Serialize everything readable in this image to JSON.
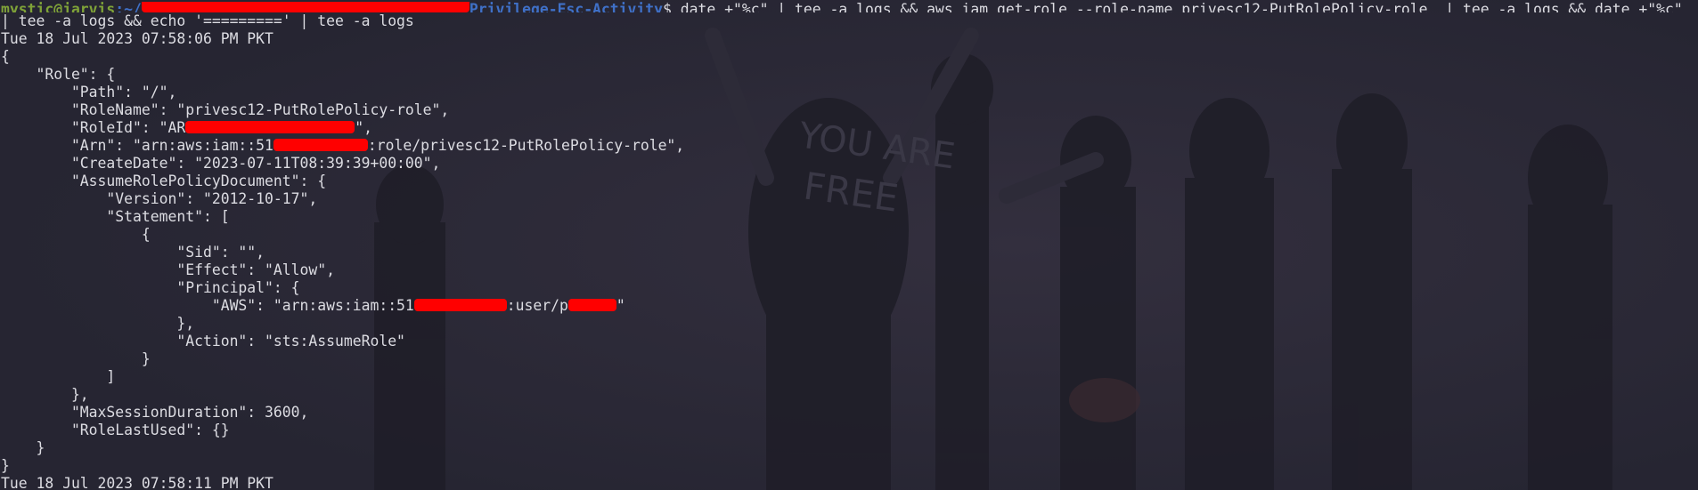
{
  "theme": {
    "background": "#262532",
    "text": "#dcdce2",
    "user_color": "#7fa238",
    "path_color": "#3f70c7",
    "redaction_color": "#ff0000"
  },
  "background_art": {
    "graffiti_line1": "YOU ARE",
    "graffiti_line2": "FREE"
  },
  "prompt": {
    "user_host": "mystic@jarvis",
    "path_prefix": ":~/",
    "path_dir": "Privilege-Esc-Activity",
    "symbol": "$",
    "command": " date +\"%c\" | tee -a logs && aws iam get-role --role-name privesc12-PutRolePolicy-role  | tee -a logs && date +\"%c\"",
    "command_cont": "| tee -a logs && echo '=========' | tee -a logs"
  },
  "output": {
    "date1": "Tue 18 Jul 2023 07:58:06 PM PKT",
    "brace_open": "{",
    "role_open": "    \"Role\": {",
    "path_line": "        \"Path\": \"/\",",
    "rolename_line": "        \"RoleName\": \"privesc12-PutRolePolicy-role\",",
    "roleid_prefix": "        \"RoleId\": \"AR",
    "roleid_suffix": "\",",
    "arn_prefix": "        \"Arn\": \"arn:aws:iam::51",
    "arn_suffix": ":role/privesc12-PutRolePolicy-role\",",
    "createdate_line": "        \"CreateDate\": \"2023-07-11T08:39:39+00:00\",",
    "assume_open": "        \"AssumeRolePolicyDocument\": {",
    "version_line": "            \"Version\": \"2012-10-17\",",
    "statement_open": "            \"Statement\": [",
    "obj_open": "                {",
    "sid_line": "                    \"Sid\": \"\",",
    "effect_line": "                    \"Effect\": \"Allow\",",
    "principal_open": "                    \"Principal\": {",
    "aws_prefix": "                        \"AWS\": \"arn:aws:iam::51",
    "aws_mid": ":user/p",
    "aws_suffix": "\"",
    "principal_close": "                    },",
    "action_line": "                    \"Action\": \"sts:AssumeRole\"",
    "obj_close": "                }",
    "statement_close": "            ]",
    "assume_close": "        },",
    "maxsession_line": "        \"MaxSessionDuration\": 3600,",
    "lastused_line": "        \"RoleLastUsed\": {}",
    "role_close": "    }",
    "brace_close": "}",
    "date2": "Tue 18 Jul 2023 07:58:11 PM PKT"
  }
}
